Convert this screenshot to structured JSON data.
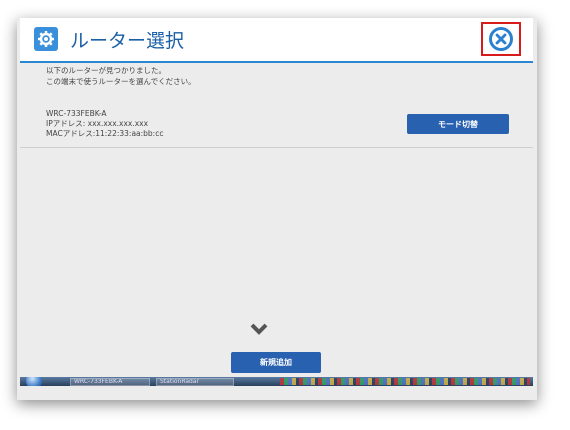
{
  "window": {
    "title": "ルーター選択"
  },
  "intro": {
    "line1": "以下のルーターが見つかりました。",
    "line2": "この端末で使うルーターを選んでください。"
  },
  "router": {
    "model": "WRC-733FEBK-A",
    "ip": "IPアドレス: xxx.xxx.xxx.xxx",
    "mac": "MACアドレス:11:22:33:aa:bb:cc",
    "mode_button": "モード切替"
  },
  "footer": {
    "add_button": "新規追加"
  },
  "taskbar": {
    "item1": "WRC-733FEBK-A",
    "item2": "StationRadar"
  },
  "colors": {
    "accent": "#2b80d0",
    "button": "#2761b0",
    "highlight": "#d71b1b",
    "background": "#ececec"
  }
}
